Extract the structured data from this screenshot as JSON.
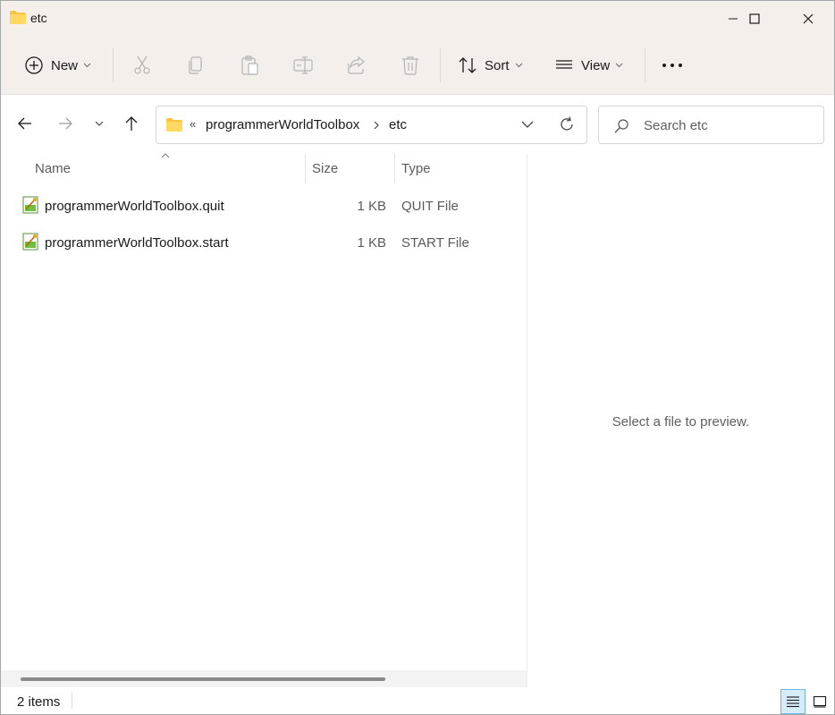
{
  "window": {
    "title": "etc"
  },
  "toolbar": {
    "new_label": "New",
    "sort_label": "Sort",
    "view_label": "View"
  },
  "address": {
    "crumbs": [
      "programmerWorldToolbox",
      "etc"
    ]
  },
  "search": {
    "placeholder": "Search etc"
  },
  "columns": {
    "name": "Name",
    "size": "Size",
    "type": "Type"
  },
  "files": [
    {
      "name": "programmerWorldToolbox.quit",
      "size": "1 KB",
      "type": "QUIT File"
    },
    {
      "name": "programmerWorldToolbox.start",
      "size": "1 KB",
      "type": "START File"
    }
  ],
  "preview": {
    "message": "Select a file to preview."
  },
  "status": {
    "count": "2 items"
  },
  "colors": {
    "folder": "#f6c342",
    "accent": "#0067c0",
    "titlebar": "#f5efec"
  }
}
